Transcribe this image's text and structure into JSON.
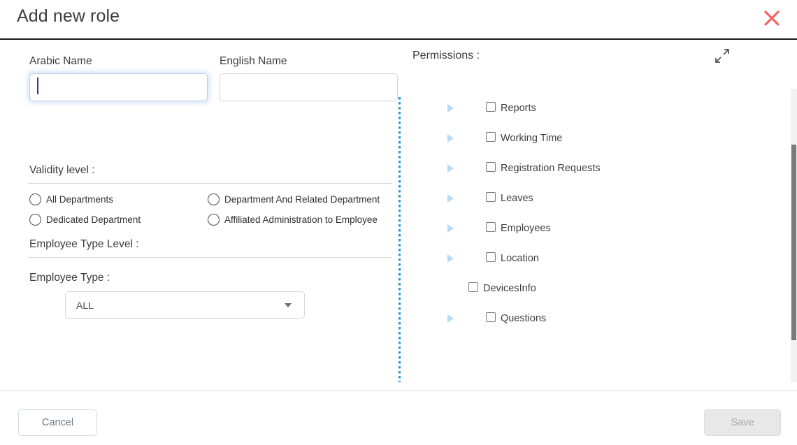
{
  "header": {
    "title": "Add new role",
    "close_icon": "close-icon",
    "close_color": "#F4645F"
  },
  "form": {
    "arabic_name": {
      "label": "Arabic Name",
      "value": "",
      "placeholder": "",
      "focused": true
    },
    "english_name": {
      "label": "English Name",
      "value": "",
      "placeholder": "",
      "focused": false
    },
    "validity_level": {
      "label": "Validity level :",
      "options": [
        {
          "label": "All Departments",
          "selected": false
        },
        {
          "label": "Department And Related Department",
          "selected": false
        },
        {
          "label": "Dedicated Department",
          "selected": false
        },
        {
          "label": "Affiliated Administration to Employee",
          "selected": false
        }
      ]
    },
    "employee_type_level": {
      "label": "Employee Type Level :"
    },
    "employee_type": {
      "label": "Employee Type :",
      "selected": "ALL",
      "options": [
        "ALL"
      ],
      "arrow_icon": "chevron-down-icon"
    }
  },
  "permissions": {
    "title": "Permissions :",
    "expand_icon": "expand-fullscreen-icon",
    "toggle_icon": "triangle-right-icon",
    "divider_color": "#1E9BE0",
    "items": [
      {
        "label": "Reports",
        "checked": false,
        "expandable": true,
        "indent": 1
      },
      {
        "label": "Working Time",
        "checked": false,
        "expandable": true,
        "indent": 1
      },
      {
        "label": "Registration Requests",
        "checked": false,
        "expandable": true,
        "indent": 1
      },
      {
        "label": "Leaves",
        "checked": false,
        "expandable": true,
        "indent": 1
      },
      {
        "label": "Employees",
        "checked": false,
        "expandable": true,
        "indent": 1
      },
      {
        "label": "Location",
        "checked": false,
        "expandable": true,
        "indent": 1
      },
      {
        "label": "DevicesInfo",
        "checked": false,
        "expandable": false,
        "indent": 0
      },
      {
        "label": "Questions",
        "checked": false,
        "expandable": true,
        "indent": 1
      }
    ]
  },
  "footer": {
    "cancel_label": "Cancel",
    "save_label": "Save",
    "save_disabled": true
  }
}
